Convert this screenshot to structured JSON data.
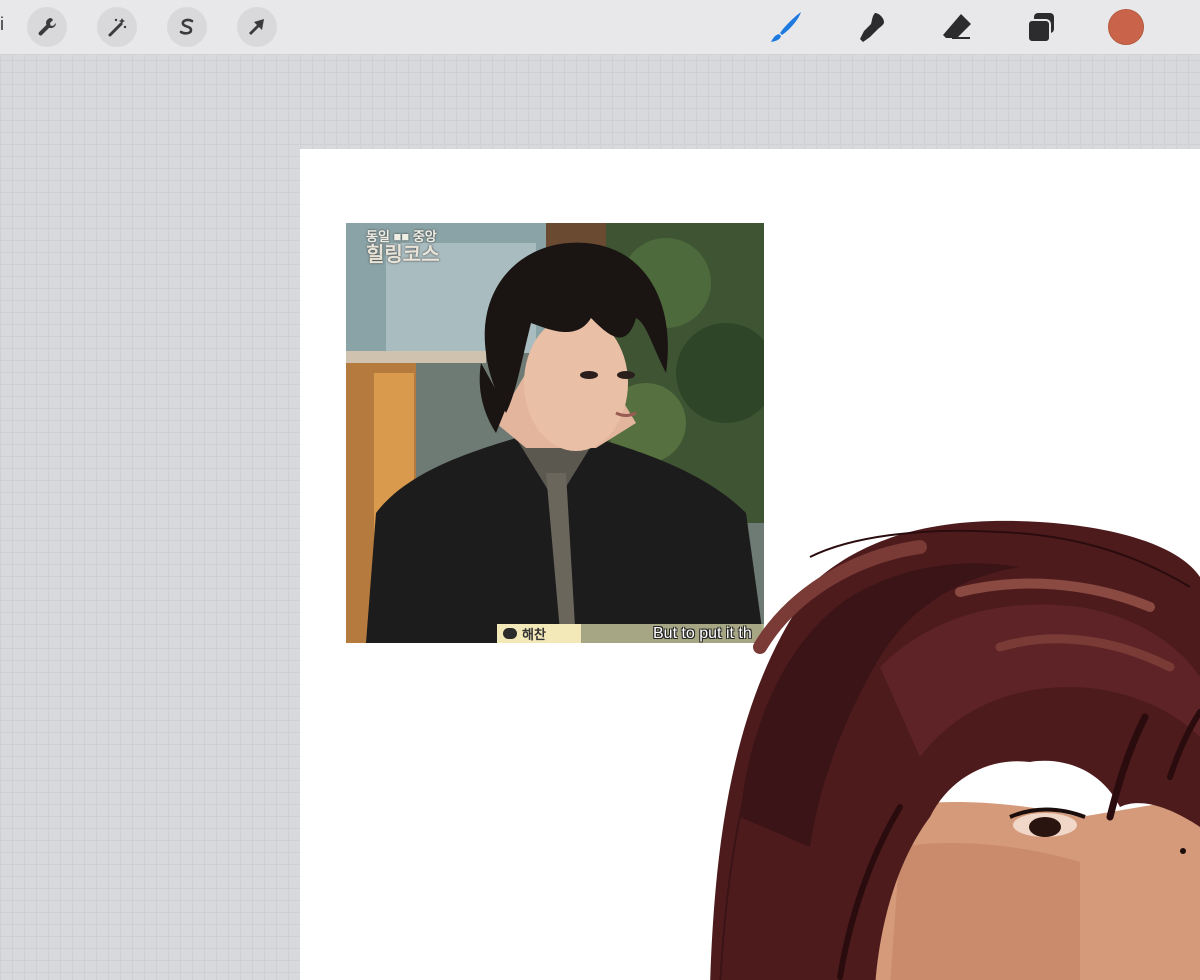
{
  "toolbar": {
    "gallery_mark": "i",
    "left_tools": [
      {
        "name": "actions",
        "icon": "wrench-icon"
      },
      {
        "name": "adjustments",
        "icon": "magic-wand-icon"
      },
      {
        "name": "selection",
        "icon": "selection-s-icon"
      },
      {
        "name": "transform",
        "icon": "arrow-cursor-icon"
      }
    ],
    "right_tools": [
      {
        "name": "brush",
        "icon": "brush-icon",
        "active": true
      },
      {
        "name": "smudge",
        "icon": "smudge-icon",
        "active": false
      },
      {
        "name": "eraser",
        "icon": "eraser-icon",
        "active": false
      },
      {
        "name": "layers",
        "icon": "layers-icon",
        "active": false
      }
    ],
    "current_color": "#c9644a",
    "accent_color": "#1f7ae0"
  },
  "reference_photo": {
    "show_title_top": "동일 ■■ 중앙",
    "show_title_main": "힐링코스",
    "speaker_tag": "해찬",
    "subtitle": "But to put it th"
  },
  "colors": {
    "canvas_bg": "#ffffff",
    "workspace_bg": "#d8d9dc",
    "hair_dark": "#3a1416",
    "hair_mid": "#5a1f22",
    "skin": "#d49a7a"
  }
}
